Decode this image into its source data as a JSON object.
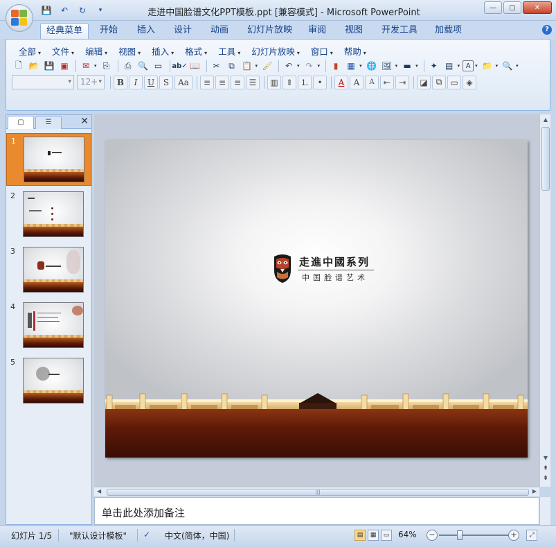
{
  "window": {
    "title": "走进中国脸谱文化PPT模板.ppt [兼容模式] - Microsoft PowerPoint",
    "controls": {
      "minimize": "—",
      "maximize": "▢",
      "close": "✕"
    }
  },
  "quick_access": [
    "save-icon",
    "undo-icon",
    "redo-icon",
    "customize-icon"
  ],
  "ribbon_tabs": [
    "经典菜单",
    "开始",
    "插入",
    "设计",
    "动画",
    "幻灯片放映",
    "审阅",
    "视图",
    "开发工具",
    "加载项"
  ],
  "active_tab": "经典菜单",
  "classic_menu": [
    "全部",
    "文件",
    "编辑",
    "视图",
    "插入",
    "格式",
    "工具",
    "幻灯片放映",
    "窗口",
    "帮助"
  ],
  "toolbar": {
    "font_name": "",
    "font_size": "12+",
    "bold": "B",
    "italic": "I",
    "underline": "U",
    "shadow": "S",
    "change_case": "Aa"
  },
  "slides_pane": {
    "slide_numbers": [
      "1",
      "2",
      "3",
      "4",
      "5"
    ],
    "selected_index": 1
  },
  "slide": {
    "title": "走進中國系列",
    "subtitle": "中国脸谱艺术"
  },
  "notes": {
    "placeholder": "单击此处添加备注"
  },
  "statusbar": {
    "slide_info": "幻灯片 1/5",
    "theme": "\"默认设计模板\"",
    "language": "中文(简体，中国)",
    "zoom": "64%",
    "zoom_out": "−",
    "zoom_in": "+"
  },
  "colors": {
    "accent_selected": "#e98a2f",
    "ribbon_border": "#8db2e3",
    "floor_dark": "#3a0d04"
  }
}
